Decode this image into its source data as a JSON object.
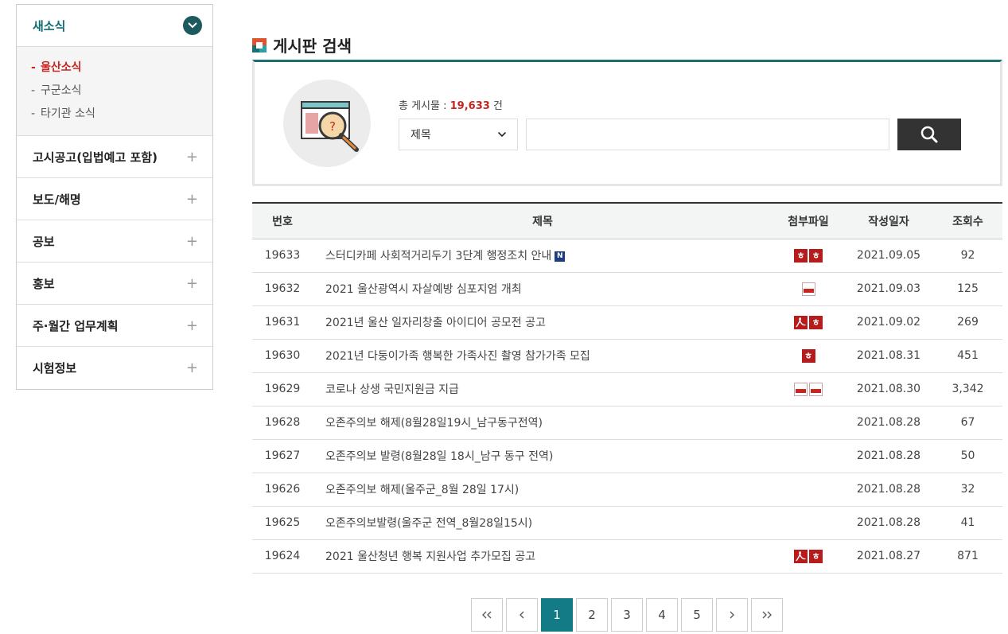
{
  "sidebar": {
    "header": "새소식",
    "sub_items": [
      {
        "label": "울산소식",
        "active": true
      },
      {
        "label": "구군소식",
        "active": false
      },
      {
        "label": "타기관 소식",
        "active": false
      }
    ],
    "items": [
      {
        "label": "고시공고(입법예고 포함)"
      },
      {
        "label": "보도/해명"
      },
      {
        "label": "공보"
      },
      {
        "label": "홍보"
      },
      {
        "label": "주·월간 업무계획"
      },
      {
        "label": "시험정보"
      }
    ],
    "plus_symbol": "+"
  },
  "page_title": "게시판 검색",
  "search": {
    "total_label": "총 게시물 : ",
    "total_count": "19,633",
    "total_unit": " 건",
    "select_value": "제목",
    "input_value": ""
  },
  "table": {
    "headers": [
      "번호",
      "제목",
      "첨부파일",
      "작성일자",
      "조회수"
    ],
    "rows": [
      {
        "no": "19633",
        "subject": "스터디카페 사회적거리두기 3단계 행정조치 안내",
        "new": true,
        "files": [
          "hwp",
          "hwp"
        ],
        "date": "2021.09.05",
        "hits": "92"
      },
      {
        "no": "19632",
        "subject": "2021 울산광역시 자살예방 심포지엄 개최",
        "new": false,
        "files": [
          "png"
        ],
        "date": "2021.09.03",
        "hits": "125"
      },
      {
        "no": "19631",
        "subject": "2021년 울산 일자리창출 아이디어 공모전 공고",
        "new": false,
        "files": [
          "pdf",
          "hwp"
        ],
        "date": "2021.09.02",
        "hits": "269"
      },
      {
        "no": "19630",
        "subject": "2021년 다둥이가족 행복한 가족사진 촬영 참가가족 모집",
        "new": false,
        "files": [
          "hwp"
        ],
        "date": "2021.08.31",
        "hits": "451"
      },
      {
        "no": "19629",
        "subject": "코로나 상생 국민지원금 지급",
        "new": false,
        "files": [
          "jpg",
          "jpg"
        ],
        "date": "2021.08.30",
        "hits": "3,342"
      },
      {
        "no": "19628",
        "subject": "오존주의보 해제(8월28일19시_남구동구전역)",
        "new": false,
        "files": [],
        "date": "2021.08.28",
        "hits": "67"
      },
      {
        "no": "19627",
        "subject": "오존주의보 발령(8월28일 18시_남구 동구 전역)",
        "new": false,
        "files": [],
        "date": "2021.08.28",
        "hits": "50"
      },
      {
        "no": "19626",
        "subject": "오존주의보 해제(울주군_8월 28일 17시)",
        "new": false,
        "files": [],
        "date": "2021.08.28",
        "hits": "32"
      },
      {
        "no": "19625",
        "subject": "오존주의보발령(울주군 전역_8월28일15시)",
        "new": false,
        "files": [],
        "date": "2021.08.28",
        "hits": "41"
      },
      {
        "no": "19624",
        "subject": "2021 울산청년 행복 지원사업 추가모집 공고",
        "new": false,
        "files": [
          "pdf",
          "hwp"
        ],
        "date": "2021.08.27",
        "hits": "871"
      }
    ]
  },
  "pagination": {
    "first": "«",
    "prev": "‹",
    "pages": [
      "1",
      "2",
      "3",
      "4",
      "5"
    ],
    "current": "1",
    "next": "›",
    "last": "»"
  },
  "colors": {
    "accent": "#137b86",
    "highlight_red": "#c9251f",
    "dark_button": "#333333"
  }
}
